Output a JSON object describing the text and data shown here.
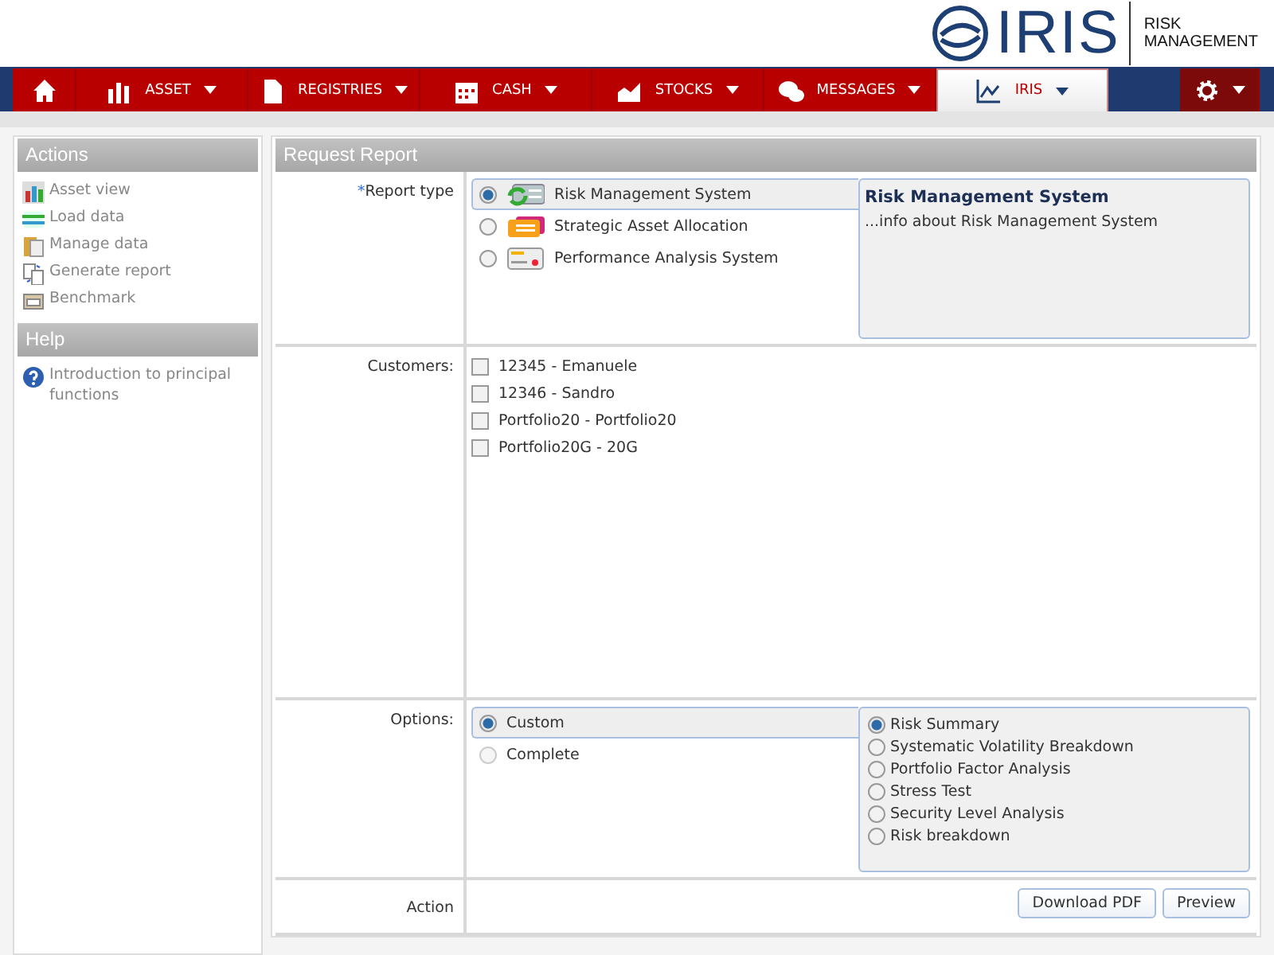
{
  "logo": {
    "name": "IRIS",
    "tagline_1": "RISK",
    "tagline_2": "MANAGEMENT"
  },
  "nav": [
    {
      "kind": "home",
      "selected": false
    },
    {
      "kind": "bars",
      "label": "ASSET",
      "selected": false
    },
    {
      "kind": "doc",
      "label": "REGISTRIES",
      "selected": false
    },
    {
      "kind": "calendar",
      "label": "CASH",
      "selected": false
    },
    {
      "kind": "area",
      "label": "STOCKS",
      "selected": false
    },
    {
      "kind": "chat",
      "label": "MESSAGES",
      "selected": false
    },
    {
      "kind": "line",
      "label": "IRIS",
      "selected": true
    },
    {
      "kind": "settings",
      "selected": false
    }
  ],
  "sidebar": [
    {
      "title": "Actions",
      "items": [
        {
          "kind": "chart",
          "label": "Asset view"
        },
        {
          "kind": "list",
          "label": "Load data"
        },
        {
          "kind": "folder",
          "label": "Manage data"
        },
        {
          "kind": "pages",
          "label": "Generate report"
        },
        {
          "kind": "bench",
          "label": "Benchmark"
        }
      ]
    },
    {
      "title": "Help",
      "items": [
        {
          "kind": "help",
          "label": "Introduction to principal functions"
        }
      ]
    }
  ],
  "form": {
    "title": "Request Report",
    "report_type": {
      "mark": "*",
      "label": "Report type",
      "options": [
        {
          "kind": "rms",
          "label": "Risk Management System",
          "selected": true
        },
        {
          "kind": "saa",
          "label": "Strategic Asset Allocation",
          "selected": false
        },
        {
          "kind": "pas",
          "label": "Performance Analysis System",
          "selected": false
        }
      ],
      "info_title": "Risk Management System",
      "info_text": "...info about Risk Management System"
    },
    "customers": {
      "label": "Customers:",
      "items": [
        {
          "label": "12345 - Emanuele",
          "checked": false
        },
        {
          "label": "12346 - Sandro",
          "checked": false
        },
        {
          "label": "Portfolio20 - Portfolio20",
          "checked": false
        },
        {
          "label": "Portfolio20G - 20G",
          "checked": false
        }
      ]
    },
    "options": {
      "label": "Options:",
      "modes": [
        {
          "label": "Custom",
          "selected": true,
          "disabled": false
        },
        {
          "label": "Complete",
          "selected": false,
          "disabled": true
        }
      ],
      "sections": [
        {
          "label": "Risk Summary",
          "selected": true
        },
        {
          "label": "Systematic Volatility Breakdown",
          "selected": false
        },
        {
          "label": "Portfolio Factor Analysis",
          "selected": false
        },
        {
          "label": "Stress Test",
          "selected": false
        },
        {
          "label": "Security Level Analysis",
          "selected": false
        },
        {
          "label": "Risk breakdown",
          "selected": false
        }
      ]
    },
    "action": {
      "label": "Action",
      "buttons": [
        "Download PDF",
        "Preview"
      ]
    }
  }
}
